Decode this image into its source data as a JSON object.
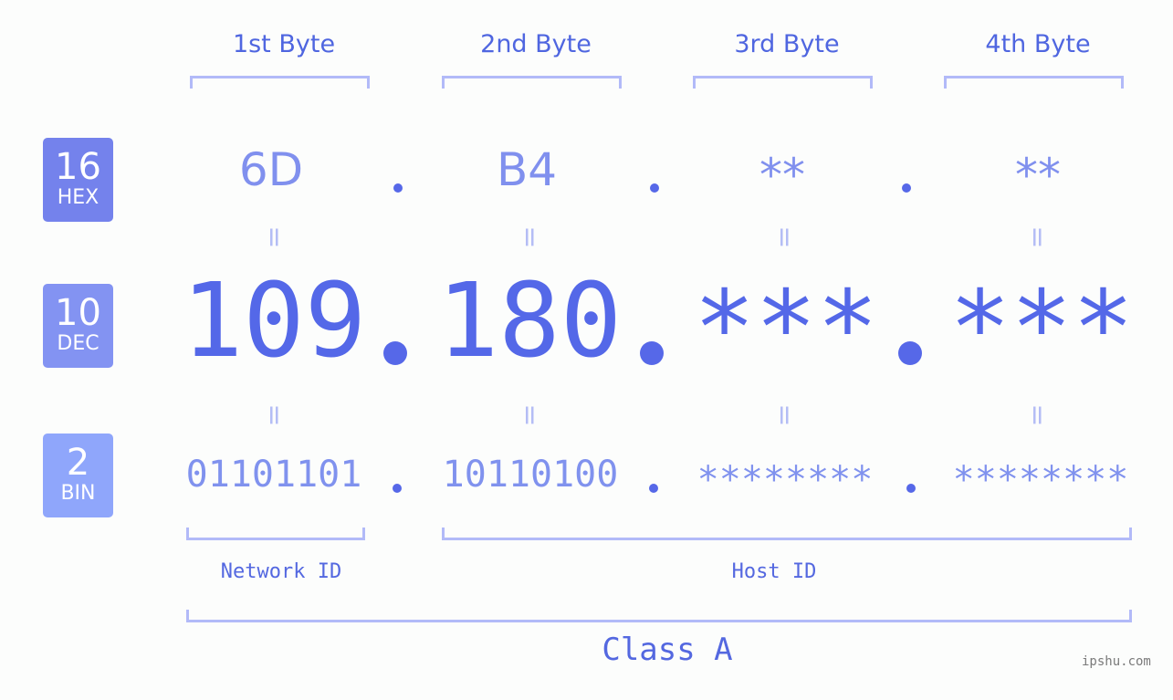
{
  "bytes": {
    "labels": [
      "1st Byte",
      "2nd Byte",
      "3rd Byte",
      "4th Byte"
    ]
  },
  "badges": {
    "hex": {
      "base": "16",
      "label": "HEX",
      "color": "#7482ec"
    },
    "dec": {
      "base": "10",
      "label": "DEC",
      "color": "#8393f2"
    },
    "bin": {
      "base": "2",
      "label": "BIN",
      "color": "#8fa6fb"
    }
  },
  "hex": {
    "values": [
      "6D",
      "B4",
      "**",
      "**"
    ]
  },
  "dec": {
    "values": [
      "109",
      "180",
      "***",
      "***"
    ]
  },
  "bin": {
    "values": [
      "01101101",
      "10110100",
      "********",
      "********"
    ]
  },
  "equals_symbol": "=",
  "network_id_label": "Network ID",
  "host_id_label": "Host ID",
  "class_label": "Class A",
  "watermark": "ipshu.com",
  "colors": {
    "primary": "#5468e8",
    "light_value": "#8090ee",
    "bracket": "#b2baf8",
    "background": "#fcfdfc"
  }
}
